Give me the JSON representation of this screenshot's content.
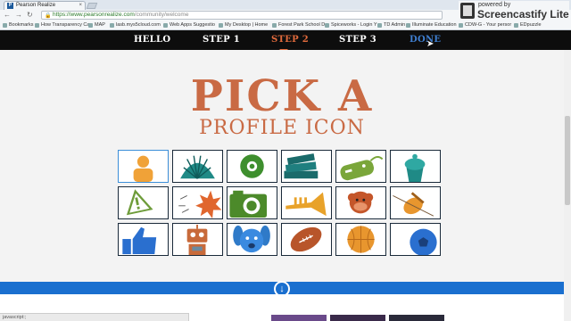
{
  "browser": {
    "tab_title": "Pearson Realize",
    "tab_favicon": "P",
    "url_scheme_host": "https://www.pearsonrealize.com",
    "url_path": "/community/welcome",
    "bookmarks": [
      "Bookmarks",
      "How Transparency Ca",
      "MAP",
      "lasb.mys5cloud.com",
      "Web Apps Suggestio",
      "My Desktop | Home",
      "Forest Park School D",
      "Spiceworks - Login Y",
      "TD Admin",
      "Illuminate Education",
      "CDW-G - Your persor",
      "EDpuzzle"
    ],
    "status_text": "javascript:;"
  },
  "castify": {
    "powered_by": "powered by",
    "brand": "Screencastify Lite"
  },
  "steps": [
    {
      "label": "HELLO",
      "state": "normal"
    },
    {
      "label": "STEP 1",
      "state": "normal"
    },
    {
      "label": "STEP 2",
      "state": "active"
    },
    {
      "label": "STEP 3",
      "state": "normal"
    },
    {
      "label": "DONE",
      "state": "done"
    }
  ],
  "heading": {
    "line1": "PICK A",
    "line2": "PROFILE ICON"
  },
  "colors": {
    "accent": "#c96a44",
    "nav_bg": "#0d0d0d",
    "active_step": "#e06a3c",
    "done_step": "#3f7fd0",
    "blue_bar": "#1a6fcf"
  },
  "icons": [
    [
      "person-icon",
      "shell-icon",
      "pokeball-icon",
      "books-icon",
      "game-controller-icon",
      "cupcake-icon"
    ],
    [
      "warning-sign-icon",
      "explosion-icon",
      "camera-icon",
      "trumpet-icon",
      "monkey-icon",
      "violin-icon"
    ],
    [
      "thumbs-up-icon",
      "robot-icon",
      "dog-icon",
      "football-icon",
      "basketball-icon",
      "soccer-ball-icon"
    ]
  ],
  "selected_icon": "person-icon"
}
